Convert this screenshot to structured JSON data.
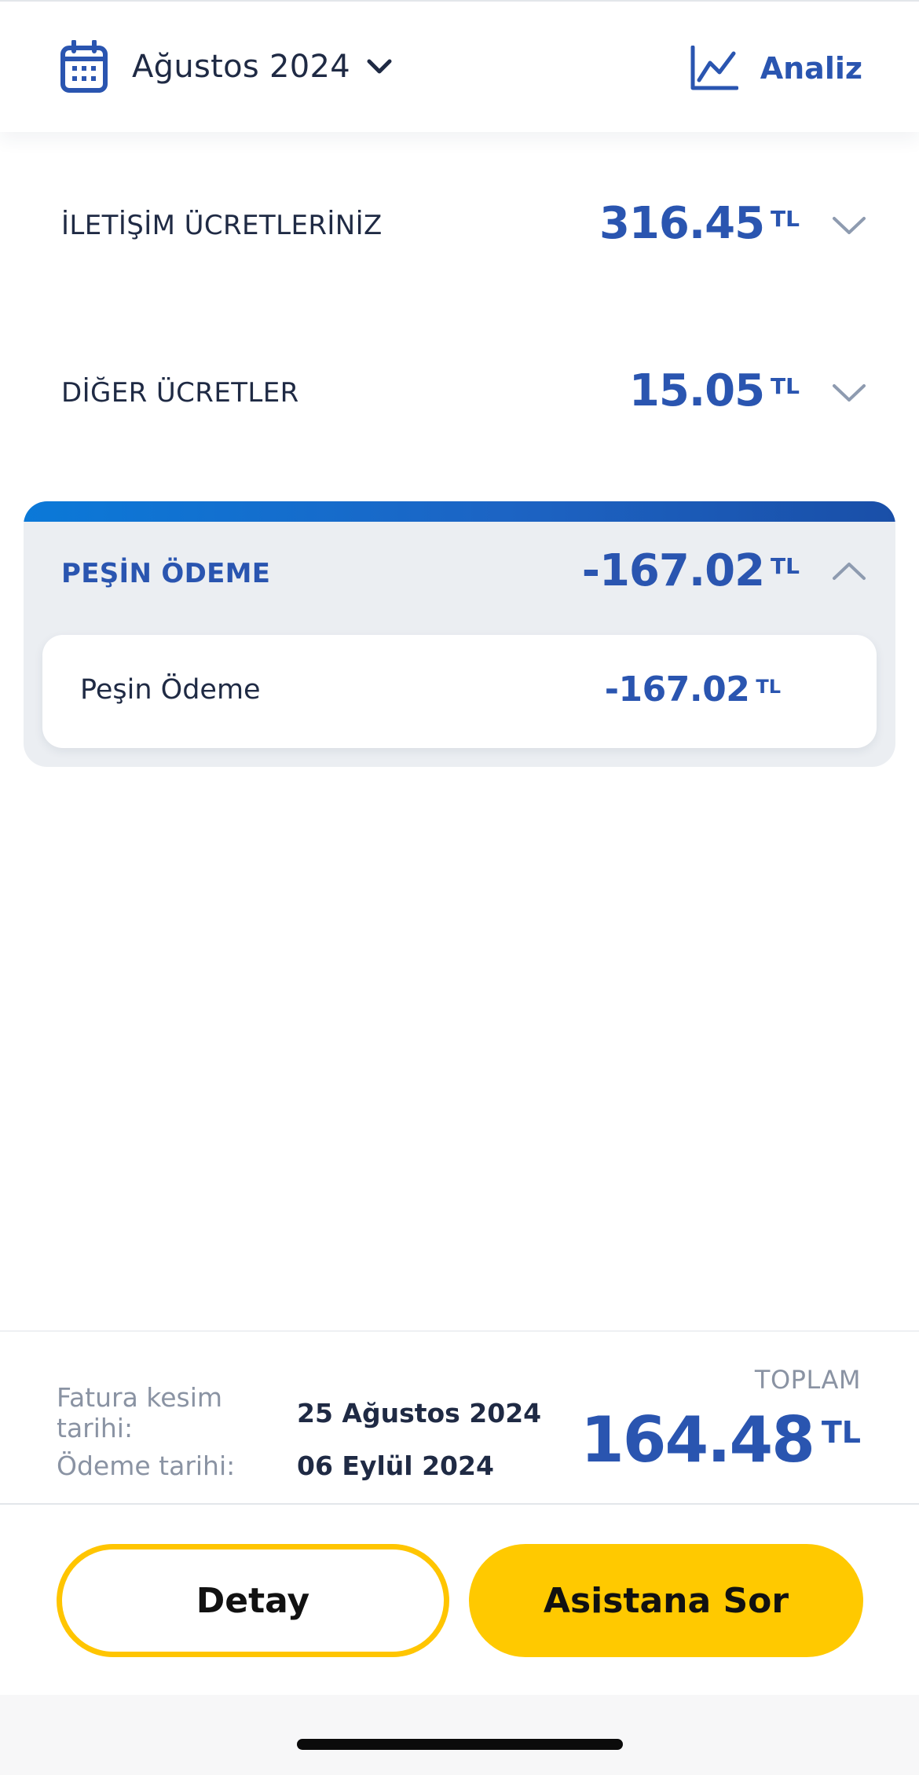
{
  "header": {
    "month_label": "Ağustos 2024",
    "analysis_label": "Analiz",
    "icons": [
      "calendar-icon",
      "chevron-down-icon",
      "line-chart-icon"
    ]
  },
  "charges": [
    {
      "label": "İLETİŞİM ÜCRETLERİNİZ",
      "amount": "316.45",
      "currency": "TL",
      "expanded": false
    },
    {
      "label": "DİĞER ÜCRETLER",
      "amount": "15.05",
      "currency": "TL",
      "expanded": false
    }
  ],
  "prepayment": {
    "label": "PEŞİN ÖDEME",
    "amount": "-167.02",
    "currency": "TL",
    "expanded": true,
    "items": [
      {
        "label": "Peşin Ödeme",
        "amount": "-167.02",
        "currency": "TL"
      }
    ]
  },
  "summary": {
    "invoice_date_label": "Fatura kesim tarihi:",
    "invoice_date": "25 Ağustos 2024",
    "due_date_label": "Ödeme tarihi:",
    "due_date": "06 Eylül 2024",
    "total_label": "TOPLAM",
    "total_amount": "164.48",
    "total_currency": "TL"
  },
  "actions": {
    "detail_label": "Detay",
    "assistant_label": "Asistana Sor"
  },
  "colors": {
    "accent_blue": "#2a55b0",
    "bar_gradient_start": "#0b79d8",
    "bar_gradient_end": "#1a4fa8",
    "yellow": "#ffc900",
    "card_bg": "#ebeef2",
    "text_dark": "#1f2a44",
    "text_muted": "#8a93a3"
  }
}
